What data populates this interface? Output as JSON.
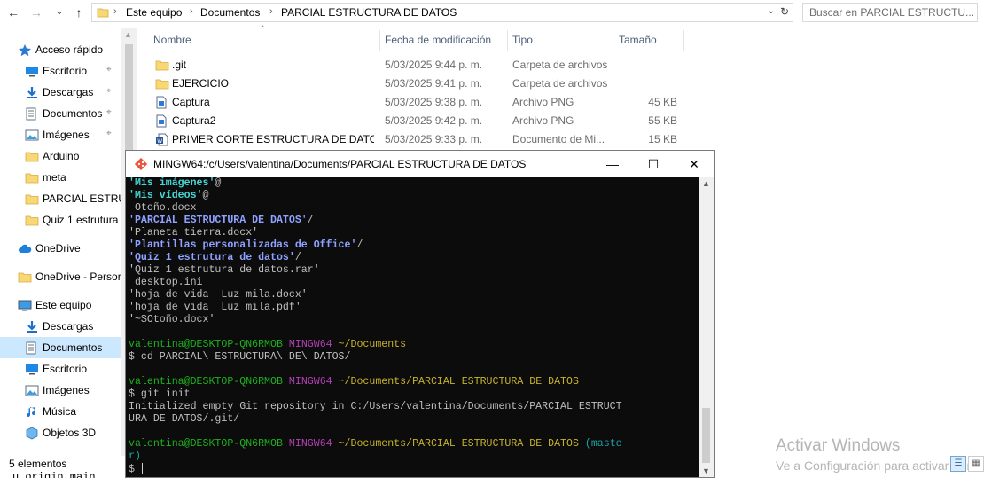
{
  "explorer": {
    "breadcrumbs": [
      "Este equipo",
      "Documentos",
      "PARCIAL ESTRUCTURA DE DATOS"
    ],
    "search_placeholder": "Buscar en PARCIAL ESTRUCTU...",
    "columns": [
      "Nombre",
      "Fecha de modificación",
      "Tipo",
      "Tamaño"
    ],
    "files": [
      {
        "name": ".git",
        "date": "5/03/2025 9:44 p. m.",
        "type": "Carpeta de archivos",
        "size": "",
        "icon": "folder-icon"
      },
      {
        "name": "EJERCICIO",
        "date": "5/03/2025 9:41 p. m.",
        "type": "Carpeta de archivos",
        "size": "",
        "icon": "folder-icon"
      },
      {
        "name": "Captura",
        "date": "5/03/2025 9:38 p. m.",
        "type": "Archivo PNG",
        "size": "45 KB",
        "icon": "png-file-icon"
      },
      {
        "name": "Captura2",
        "date": "5/03/2025 9:42 p. m.",
        "type": "Archivo PNG",
        "size": "55 KB",
        "icon": "png-file-icon"
      },
      {
        "name": "PRIMER CORTE ESTRUCTURA DE DATOS V...",
        "date": "5/03/2025 9:33 p. m.",
        "type": "Documento de Mi...",
        "size": "15 KB",
        "icon": "word-file-icon"
      }
    ],
    "sidebar": [
      {
        "label": "Acceso rápido",
        "icon": "star-icon",
        "pinned": false
      },
      {
        "label": "Escritorio",
        "icon": "desktop-icon",
        "pinned": true
      },
      {
        "label": "Descargas",
        "icon": "download-icon",
        "pinned": true
      },
      {
        "label": "Documentos",
        "icon": "documents-icon",
        "pinned": true
      },
      {
        "label": "Imágenes",
        "icon": "pictures-icon",
        "pinned": true
      },
      {
        "label": "Arduino",
        "icon": "folder-icon",
        "pinned": false
      },
      {
        "label": "meta",
        "icon": "folder-icon",
        "pinned": false
      },
      {
        "label": "PARCIAL ESTRUC",
        "icon": "folder-icon",
        "pinned": false
      },
      {
        "label": "Quiz 1 estrutura",
        "icon": "folder-icon",
        "pinned": false
      },
      {
        "label": "OneDrive",
        "icon": "cloud-icon",
        "pinned": false
      },
      {
        "label": "OneDrive - Persor",
        "icon": "folder-icon",
        "pinned": false
      },
      {
        "label": "Este equipo",
        "icon": "computer-icon",
        "pinned": false
      },
      {
        "label": "Descargas",
        "icon": "download-icon",
        "pinned": false
      },
      {
        "label": "Documentos",
        "icon": "documents-icon",
        "pinned": false,
        "selected": true
      },
      {
        "label": "Escritorio",
        "icon": "desktop-icon",
        "pinned": false
      },
      {
        "label": "Imágenes",
        "icon": "pictures-icon",
        "pinned": false
      },
      {
        "label": "Música",
        "icon": "music-icon",
        "pinned": false
      },
      {
        "label": "Objetos 3D",
        "icon": "cube-icon",
        "pinned": false
      }
    ],
    "status": "5 elementos",
    "behind_text": "u origin main"
  },
  "terminal": {
    "title": "MINGW64:/c/Users/valentina/Documents/PARCIAL ESTRUCTURA DE DATOS",
    "lines": [
      [
        {
          "t": "'Mis imágenes'",
          "c": "bcyan"
        },
        {
          "t": "@",
          "c": "plain"
        }
      ],
      [
        {
          "t": "'Mis vídeos'",
          "c": "bcyan"
        },
        {
          "t": "@",
          "c": "plain"
        }
      ],
      [
        {
          "t": " Otoño.docx",
          "c": "plain"
        }
      ],
      [
        {
          "t": "'PARCIAL ESTRUCTURA DE DATOS'",
          "c": "bblue"
        },
        {
          "t": "/",
          "c": "plain"
        }
      ],
      [
        {
          "t": "'Planeta tierra.docx'",
          "c": "plain"
        }
      ],
      [
        {
          "t": "'Plantillas personalizadas de Office'",
          "c": "bblue"
        },
        {
          "t": "/",
          "c": "plain"
        }
      ],
      [
        {
          "t": "'Quiz 1 estrutura de datos'",
          "c": "bblue"
        },
        {
          "t": "/",
          "c": "plain"
        }
      ],
      [
        {
          "t": "'Quiz 1 estrutura de datos.rar'",
          "c": "plain"
        }
      ],
      [
        {
          "t": " desktop.ini",
          "c": "plain"
        }
      ],
      [
        {
          "t": "'hoja de vida  Luz mila.docx'",
          "c": "plain"
        }
      ],
      [
        {
          "t": "'hoja de vida  Luz mila.pdf'",
          "c": "plain"
        }
      ],
      [
        {
          "t": "'~$Otoño.docx'",
          "c": "plain"
        }
      ],
      [],
      [
        {
          "t": "valentina@DESKTOP-QN6RMOB ",
          "c": "green"
        },
        {
          "t": "MINGW64 ",
          "c": "purple"
        },
        {
          "t": "~/Documents",
          "c": "yellow"
        }
      ],
      [
        {
          "t": "$ cd PARCIAL\\ ESTRUCTURA\\ DE\\ DATOS/",
          "c": "plain"
        }
      ],
      [],
      [
        {
          "t": "valentina@DESKTOP-QN6RMOB ",
          "c": "green"
        },
        {
          "t": "MINGW64 ",
          "c": "purple"
        },
        {
          "t": "~/Documents/PARCIAL ESTRUCTURA DE DATOS",
          "c": "yellow"
        }
      ],
      [
        {
          "t": "$ git init",
          "c": "plain"
        }
      ],
      [
        {
          "t": "Initialized empty Git repository in C:/Users/valentina/Documents/PARCIAL ESTRUCT",
          "c": "plain"
        }
      ],
      [
        {
          "t": "URA DE DATOS/.git/",
          "c": "plain"
        }
      ],
      [],
      [
        {
          "t": "valentina@DESKTOP-QN6RMOB ",
          "c": "green"
        },
        {
          "t": "MINGW64 ",
          "c": "purple"
        },
        {
          "t": "~/Documents/PARCIAL ESTRUCTURA DE DATOS ",
          "c": "yellow"
        },
        {
          "t": "(maste",
          "c": "cyan"
        }
      ],
      [
        {
          "t": "r)",
          "c": "cyan"
        }
      ],
      [
        {
          "t": "$ ",
          "c": "plain"
        }
      ]
    ]
  },
  "watermark": {
    "line1": "Activar Windows",
    "line2": "Ve a Configuración para activar Win"
  }
}
